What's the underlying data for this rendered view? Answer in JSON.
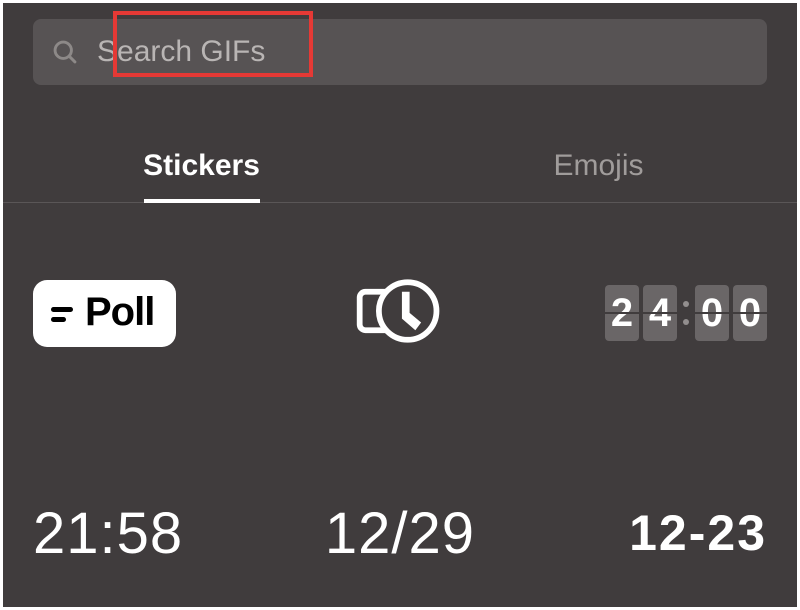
{
  "search": {
    "placeholder": "Search GIFs",
    "value": ""
  },
  "tabs": [
    {
      "label": "Stickers",
      "active": true
    },
    {
      "label": "Emojis",
      "active": false
    }
  ],
  "stickers": {
    "poll_label": "Poll",
    "flipclock": {
      "d1": "2",
      "d2": "4",
      "d3": "0",
      "d4": "0"
    },
    "time_text": "21:58",
    "date_slash": "12/29",
    "date_dash": "12-23"
  },
  "annotation": {
    "highlight": "search-placeholder"
  }
}
